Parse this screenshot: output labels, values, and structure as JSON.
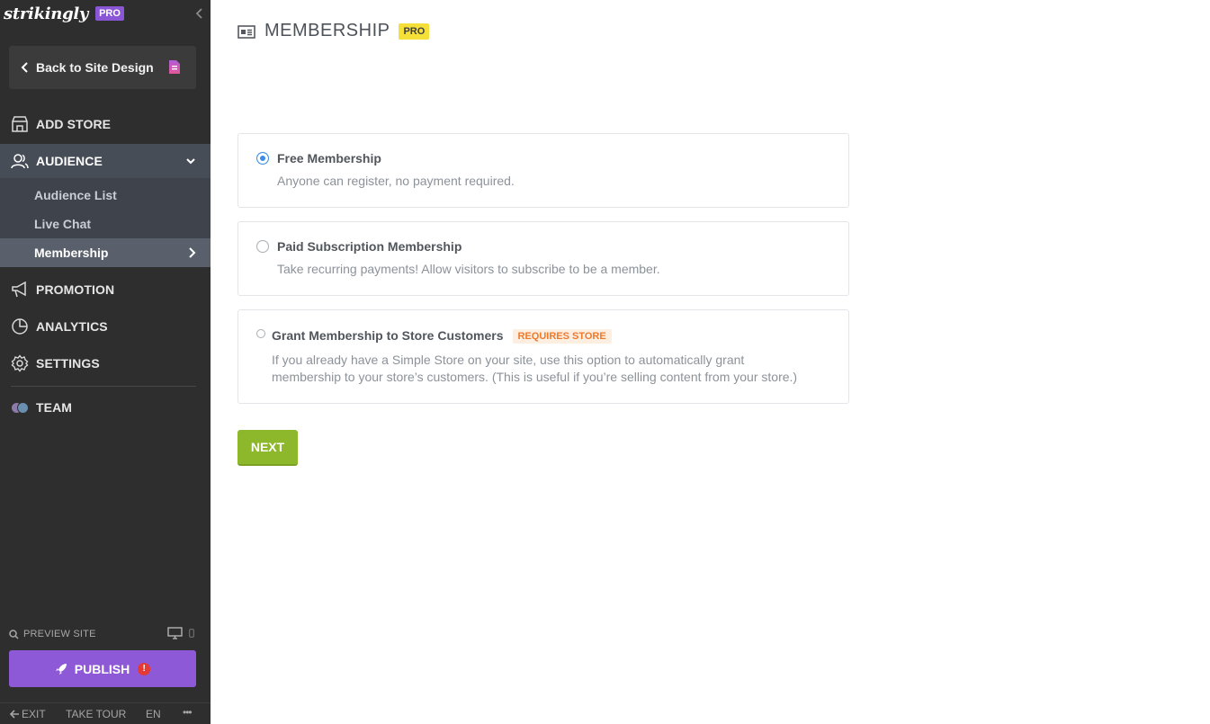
{
  "brand": {
    "name": "strikingly",
    "badge": "PRO"
  },
  "sidebar": {
    "back_label": "Back to Site Design",
    "nav": [
      {
        "label": "ADD STORE",
        "icon": "store-icon"
      },
      {
        "label": "AUDIENCE",
        "icon": "audience-icon"
      },
      {
        "label": "PROMOTION",
        "icon": "megaphone-icon"
      },
      {
        "label": "ANALYTICS",
        "icon": "pie-chart-icon"
      },
      {
        "label": "SETTINGS",
        "icon": "gear-icon"
      },
      {
        "label": "TEAM",
        "icon": "team-avatars"
      }
    ],
    "audience_sub": [
      {
        "label": "Audience List"
      },
      {
        "label": "Live Chat"
      },
      {
        "label": "Membership"
      }
    ],
    "preview_label": "PREVIEW SITE",
    "publish_label": "PUBLISH",
    "publish_alert": "!",
    "footer": {
      "exit": "EXIT",
      "tour": "TAKE TOUR",
      "lang": "EN",
      "more": "•••"
    }
  },
  "main": {
    "title": "MEMBERSHIP",
    "pro_badge": "PRO",
    "options": [
      {
        "title": "Free Membership",
        "desc": "Anyone can register, no payment required.",
        "selected": true
      },
      {
        "title": "Paid Subscription Membership",
        "desc": "Take recurring payments! Allow visitors to subscribe to be a member.",
        "selected": false
      },
      {
        "title": "Grant Membership to Store Customers",
        "badge": "REQUIRES STORE",
        "desc_line1": "If you already have a Simple Store on your site, use this option to automatically grant",
        "desc_line2": "membership to your store’s customers. (This is useful if you’re selling content from your store.)",
        "selected": false
      }
    ],
    "next_label": "NEXT"
  },
  "colors": {
    "sidebar_bg": "#2e2e2e",
    "brand_purple": "#8e59d7",
    "pro_yellow": "#f5e03a",
    "next_green": "#8db82c",
    "radio_blue": "#3b8ee8",
    "badge_orange": "#ee7a2a"
  }
}
